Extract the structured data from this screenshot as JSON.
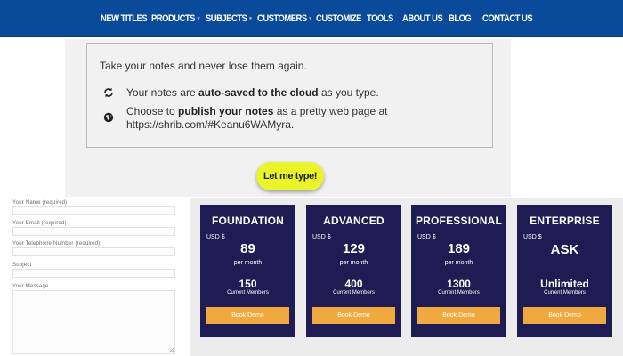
{
  "nav": {
    "items": [
      {
        "label": "NEW TITLES",
        "caret": ""
      },
      {
        "label": "PRODUCTS",
        "caret": "▾"
      },
      {
        "label": "SUBJECTS",
        "caret": "▾"
      },
      {
        "label": "CUSTOMERS",
        "caret": "▾"
      },
      {
        "label": "CUSTOMIZE",
        "caret": ""
      },
      {
        "label": "TOOLS",
        "caret": ""
      },
      {
        "label": "ABOUT US",
        "caret": ""
      },
      {
        "label": "BLOG",
        "caret": ""
      },
      {
        "label": "CONTACT US",
        "caret": ""
      }
    ]
  },
  "notes": {
    "title": "Take your notes and never lose them again.",
    "line1_pre": "Your notes are ",
    "line1_bold": "auto-saved to the cloud",
    "line1_post": " as you type.",
    "line2_pre": "Choose to ",
    "line2_bold": "publish your notes",
    "line2_post": " as a pretty web page at",
    "line2_url": "https://shrib.com/#Keanu6WAMyra.",
    "icon1": "sync-icon",
    "icon2": "globe-icon",
    "cta_label": "Let me type!"
  },
  "form": {
    "name_label": "Your Name (required)",
    "email_label": "Your Email (required)",
    "phone_label": "Your Telephone Number (required)",
    "subject_label": "Subject",
    "message_label": "Your Message"
  },
  "pricing": {
    "plans": [
      {
        "name": "FOUNDATION",
        "currency": "USD $",
        "price": "89",
        "period": "per month",
        "members": "150",
        "members_label": "Current Members",
        "button": "Book Demo"
      },
      {
        "name": "ADVANCED",
        "currency": "USD $",
        "price": "129",
        "period": "per month",
        "members": "400",
        "members_label": "Current Members",
        "button": "Book Demo"
      },
      {
        "name": "PROFESSIONAL",
        "currency": "USD $",
        "price": "189",
        "period": "per month",
        "members": "1300",
        "members_label": "Current Members",
        "button": "Book Demo"
      },
      {
        "name": "ENTERPRISE",
        "currency": "USD $",
        "price": "ASK",
        "period": "",
        "members": "Unlimited",
        "members_label": "Current Members",
        "button": "Book Demo"
      }
    ]
  },
  "colors": {
    "nav_bg": "#0a4a9a",
    "cta_bg": "#e9f42a",
    "plan_bg": "#1e1c52",
    "plan_button": "#f0a93e"
  }
}
